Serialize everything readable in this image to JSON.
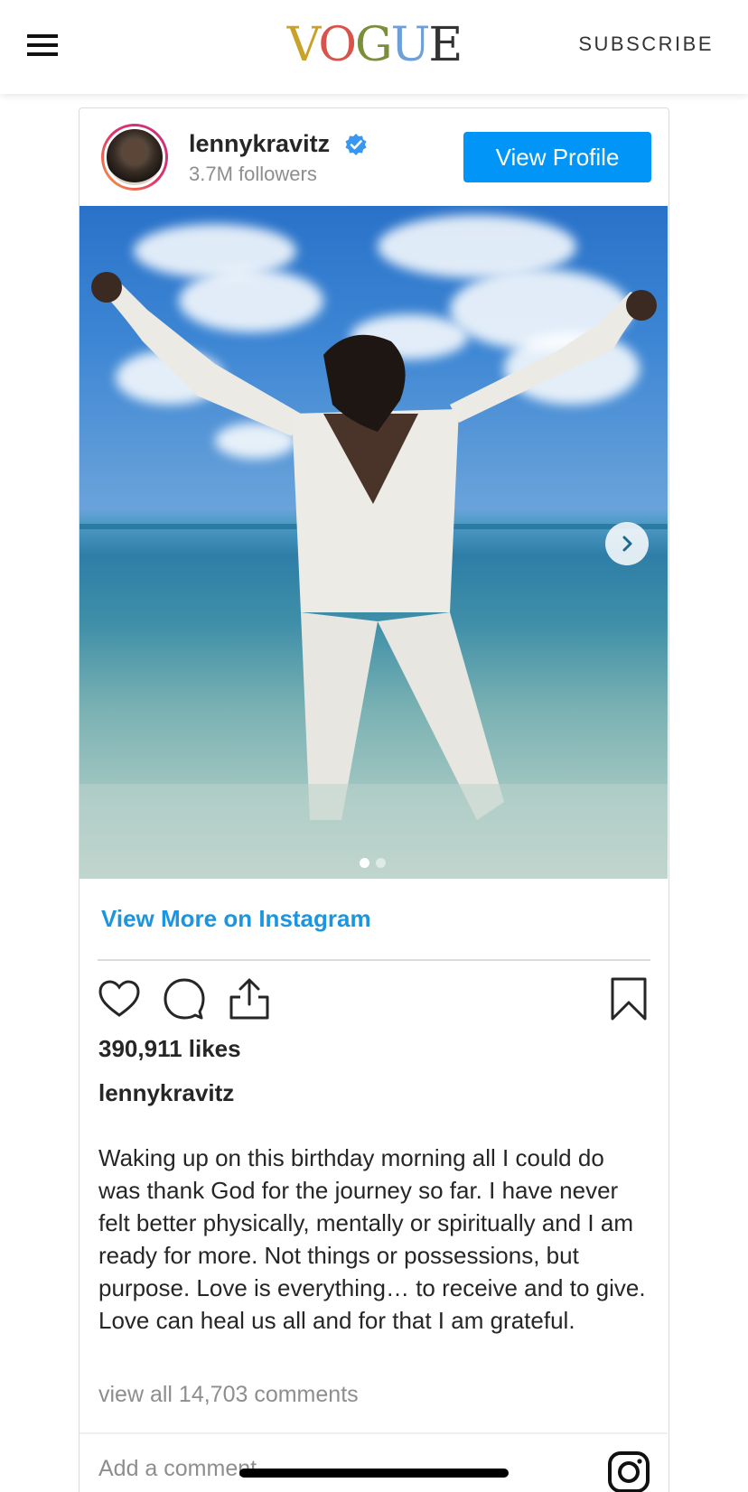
{
  "header": {
    "logo_letters": [
      "V",
      "O",
      "G",
      "U",
      "E"
    ],
    "subscribe_label": "SUBSCRIBE"
  },
  "post": {
    "username": "lennykravitz",
    "followers": "3.7M followers",
    "view_profile_label": "View Profile",
    "view_more_label": "View More on Instagram",
    "likes": "390,911 likes",
    "caption_user": "lennykravitz",
    "caption": "Waking up on this birthday morning all I could do was thank God for the journey so far. I have never felt better physically, mentally or spiritually and I am ready for more. Not things or possessions, but purpose. Love is everything… to receive and to give. Love can heal us all and for that I am grateful.",
    "comments_link": "view all 14,703 comments",
    "add_comment_placeholder": "Add a comment...",
    "carousel": {
      "current": 1,
      "total": 2
    }
  },
  "icons": {
    "menu": "hamburger-icon",
    "verified": "verified-badge-icon",
    "next": "chevron-right-icon",
    "like": "heart-icon",
    "comment": "speech-bubble-icon",
    "share": "share-icon",
    "save": "bookmark-icon",
    "instagram": "instagram-icon"
  },
  "colors": {
    "accent": "#0095f6",
    "link": "#1b95e0",
    "muted": "#8e8e8e",
    "text": "#262626"
  }
}
